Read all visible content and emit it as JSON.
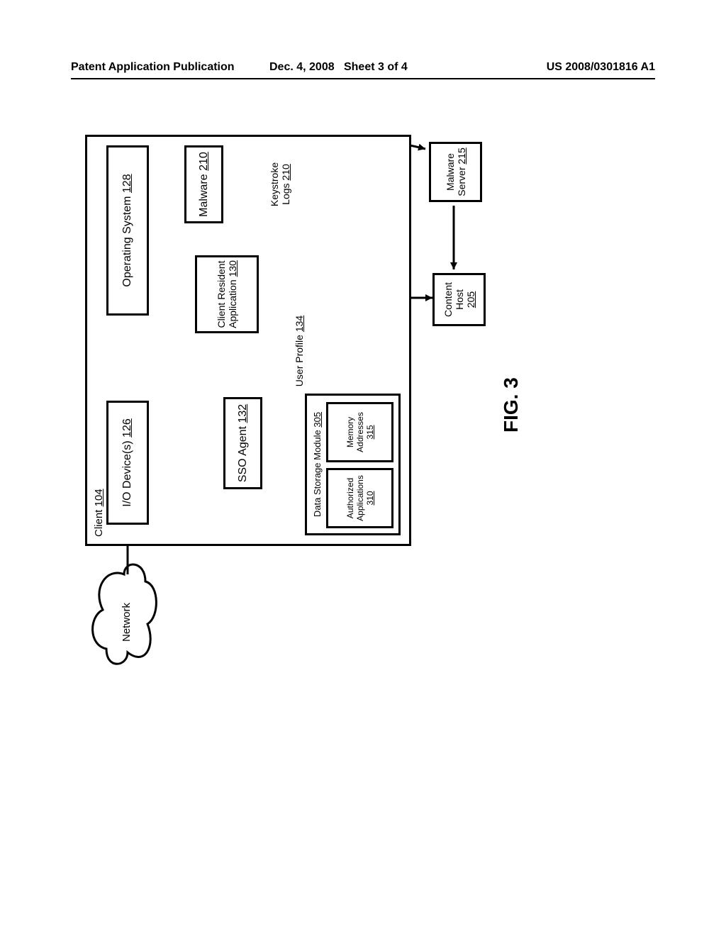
{
  "header": {
    "left": "Patent Application Publication",
    "mid_date": "Dec. 4, 2008",
    "mid_sheet": "Sheet 3 of 4",
    "right": "US 2008/0301816 A1"
  },
  "figure_label": "FIG. 3",
  "client": {
    "label": "Client",
    "num": "104"
  },
  "io": {
    "label": "I/O Device(s)",
    "num": "126"
  },
  "os": {
    "label": "Operating System",
    "num": "128"
  },
  "sso": {
    "label": "SSO Agent",
    "num": "132"
  },
  "client_app": {
    "line1": "Client Resident",
    "line2": "Application",
    "num": "130"
  },
  "malware": {
    "label": "Malware",
    "num": "210"
  },
  "keystroke": {
    "line1": "Keystroke",
    "line2": "Logs",
    "num": "210"
  },
  "user_profile": {
    "label": "User Profile",
    "num": "134"
  },
  "dsm": {
    "label": "Data Storage Module",
    "num": "305"
  },
  "auth_apps": {
    "line1": "Authorized",
    "line2": "Applications",
    "num": "310"
  },
  "mem_addr": {
    "line1": "Memory",
    "line2": "Addresses",
    "num": "315"
  },
  "malware_server": {
    "line1": "Malware",
    "line2": "Server",
    "num": "215"
  },
  "content_host": {
    "line1": "Content",
    "line2": "Host",
    "num": "205"
  },
  "network": {
    "label": "Network"
  }
}
